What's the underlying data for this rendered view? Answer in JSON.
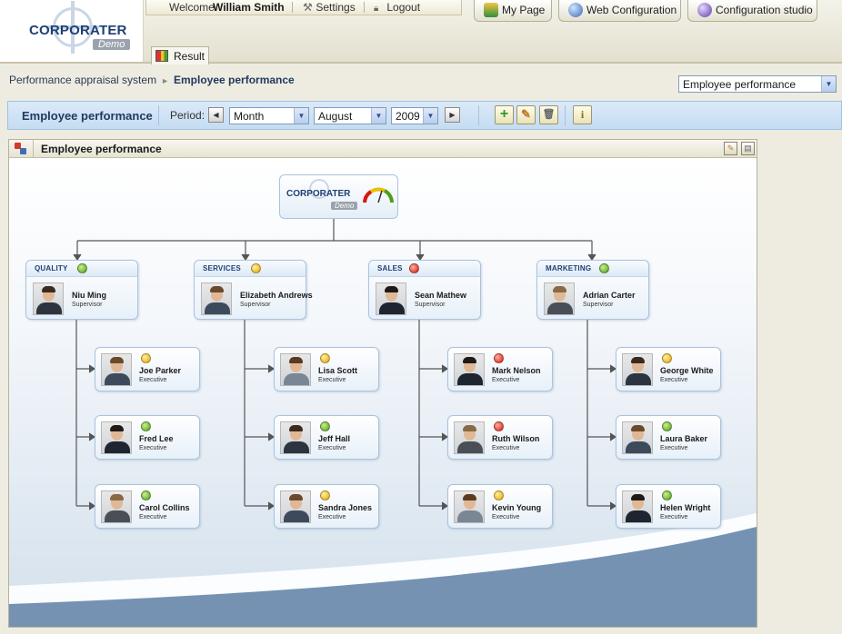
{
  "header": {
    "logo_text": "CORPORATER",
    "logo_demo": "Demo",
    "welcome_label": "Welcome",
    "user_name": "William Smith",
    "settings_label": "Settings",
    "logout_label": "Logout",
    "nav_buttons": [
      {
        "label": "My Page",
        "icon": "person-icon"
      },
      {
        "label": "Web Configuration",
        "icon": "globe-icon"
      },
      {
        "label": "Configuration studio",
        "icon": "studio-icon"
      }
    ],
    "result_tab_label": "Result"
  },
  "breadcrumb": {
    "parent": "Performance appraisal system",
    "separator": "►",
    "current": "Employee performance"
  },
  "page_select": {
    "value": "Employee performance"
  },
  "toolbar": {
    "title": "Employee performance",
    "period_label": "Period:",
    "period_type": "Month",
    "month": "August",
    "year": "2009",
    "actions": [
      "add-icon",
      "edit-icon",
      "delete-icon",
      "info-icon"
    ]
  },
  "panel": {
    "title": "Employee performance"
  },
  "org_chart": {
    "logo_text": "CORPORATER",
    "logo_demo": "Demo",
    "colors": {
      "green": "#4f9c1d",
      "yellow": "#e8a300",
      "red": "#d4190c"
    },
    "departments": [
      {
        "name": "QUALITY",
        "status": "green",
        "head": {
          "name": "Niu Ming",
          "role": "Supervisor"
        },
        "employees": [
          {
            "name": "Joe Parker",
            "role": "Executive",
            "status": "yellow"
          },
          {
            "name": "Fred Lee",
            "role": "Executive",
            "status": "green"
          },
          {
            "name": "Carol Collins",
            "role": "Executive",
            "status": "green"
          }
        ]
      },
      {
        "name": "SERVICES",
        "status": "yellow",
        "head": {
          "name": "Elizabeth Andrews",
          "role": "Supervisor"
        },
        "employees": [
          {
            "name": "Lisa Scott",
            "role": "Executive",
            "status": "yellow"
          },
          {
            "name": "Jeff Hall",
            "role": "Executive",
            "status": "green"
          },
          {
            "name": "Sandra Jones",
            "role": "Executive",
            "status": "yellow"
          }
        ]
      },
      {
        "name": "SALES",
        "status": "red",
        "head": {
          "name": "Sean Mathew",
          "role": "Supervisor"
        },
        "employees": [
          {
            "name": "Mark Nelson",
            "role": "Executive",
            "status": "red"
          },
          {
            "name": "Ruth Wilson",
            "role": "Executive",
            "status": "red"
          },
          {
            "name": "Kevin Young",
            "role": "Executive",
            "status": "yellow"
          }
        ]
      },
      {
        "name": "MARKETING",
        "status": "green",
        "head": {
          "name": "Adrian Carter",
          "role": "Supervisor"
        },
        "employees": [
          {
            "name": "George White",
            "role": "Executive",
            "status": "yellow"
          },
          {
            "name": "Laura Baker",
            "role": "Executive",
            "status": "green"
          },
          {
            "name": "Helen Wright",
            "role": "Executive",
            "status": "green"
          }
        ]
      }
    ]
  }
}
